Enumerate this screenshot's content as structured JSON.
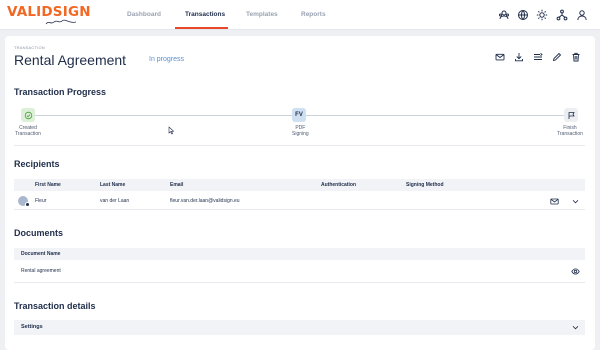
{
  "brand": {
    "logo_text": "VALIDSIGN",
    "accent": "#f26722",
    "active_tab_underline": "#e8492b"
  },
  "nav": {
    "tabs": [
      {
        "label": "Dashboard"
      },
      {
        "label": "Transactions"
      },
      {
        "label": "Templates"
      },
      {
        "label": "Reports"
      }
    ],
    "active_tab": "Transactions",
    "icons": [
      "users-icon",
      "globe-icon",
      "sun-icon",
      "network-icon",
      "profile-icon"
    ]
  },
  "page": {
    "breadcrumb": "TRANSACTION",
    "title": "Rental Agreement",
    "status": "In progress",
    "status_color": "#5b8fd4",
    "actions": [
      "mail-icon",
      "download-icon",
      "list-icon",
      "edit-icon",
      "trash-icon"
    ]
  },
  "progress": {
    "title": "Transaction Progress",
    "steps": [
      {
        "label_line1": "Created",
        "label_line2": "Transaction",
        "icon": "check-icon",
        "state": "done",
        "color": "#dcefd7"
      },
      {
        "label_line1": "PDF",
        "label_line2": "Signing",
        "icon_text": "FV",
        "state": "current",
        "color": "#cfe0f3"
      },
      {
        "label_line1": "Finish",
        "label_line2": "Transaction",
        "icon": "flag-icon",
        "state": "pending",
        "color": "#eceef1"
      }
    ]
  },
  "recipients": {
    "title": "Recipients",
    "columns": [
      "First Name",
      "Last Name",
      "Email",
      "Authentication",
      "Signing Method"
    ],
    "rows": [
      {
        "first_name": "Fleur",
        "last_name": "van der Laan",
        "email": "fleur.van.der.laan@validsign.eu",
        "authentication": "",
        "signing_method": ""
      }
    ]
  },
  "documents": {
    "title": "Documents",
    "columns": [
      "Document Name"
    ],
    "rows": [
      {
        "name": "Rental agreement"
      }
    ]
  },
  "details": {
    "title": "Transaction details",
    "settings_label": "Settings"
  }
}
